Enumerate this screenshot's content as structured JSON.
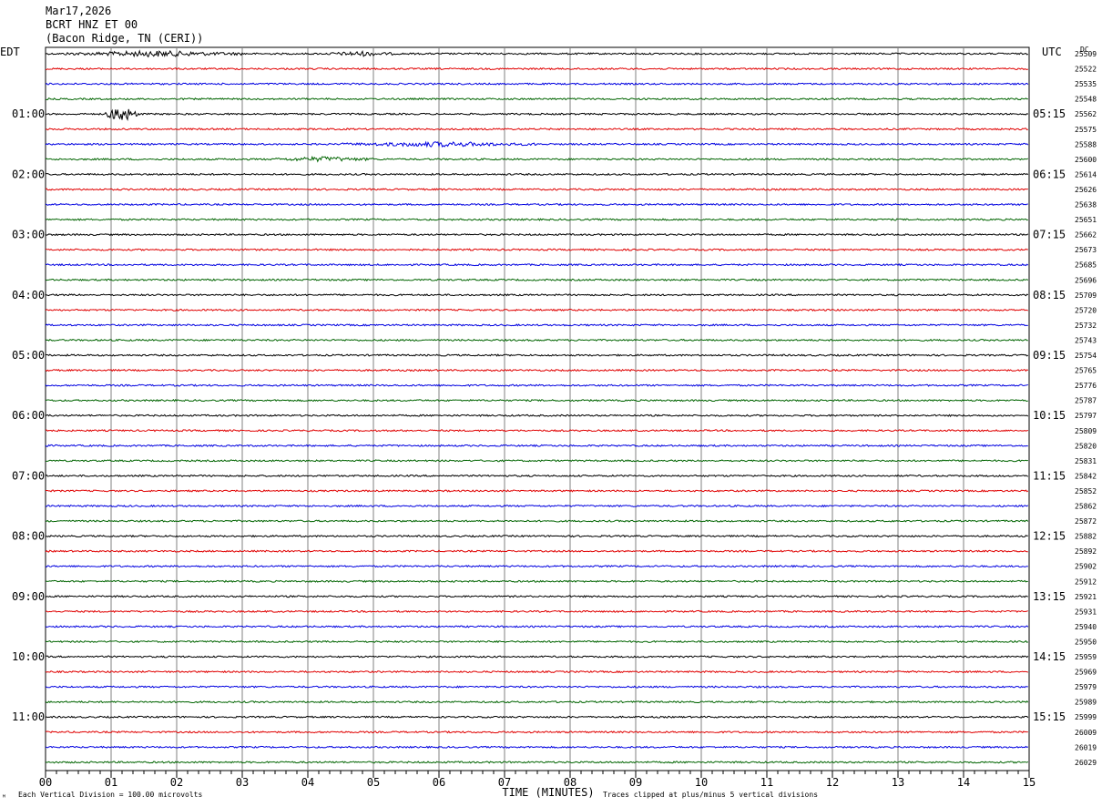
{
  "header": {
    "date": "Mar17,2026",
    "station": "BCRT HNZ ET 00",
    "location": "(Bacon Ridge, TN (CERI))"
  },
  "left_timezone": "EDT",
  "right_timezone": "UTC",
  "dc_label": "DC",
  "footer": {
    "scale_note": "Each Vertical Division =  100.00 microvolts",
    "clip_note": "Traces clipped at plus/minus 5 vertical divisions",
    "corner_mark": "ᴹ"
  },
  "colors": {
    "trace_cycle": [
      "#000000",
      "#e00000",
      "#0000e0",
      "#006400"
    ],
    "grid": "#808080",
    "background": "#ffffff"
  },
  "chart_data": {
    "type": "line",
    "title": "",
    "xlabel": "TIME (MINUTES)",
    "ylabel": "",
    "xlim": [
      0,
      15
    ],
    "x_ticks": [
      "00",
      "01",
      "02",
      "03",
      "04",
      "05",
      "06",
      "07",
      "08",
      "09",
      "10",
      "11",
      "12",
      "13",
      "14",
      "15"
    ],
    "grid": true,
    "row_count": 48,
    "left_hour_labels": [
      "01:00",
      "02:00",
      "03:00",
      "04:00",
      "05:00",
      "06:00",
      "07:00",
      "08:00",
      "09:00",
      "10:00",
      "11:00"
    ],
    "right_hour_labels": [
      "05:15",
      "06:15",
      "07:15",
      "08:15",
      "09:15",
      "10:15",
      "11:15",
      "12:15",
      "13:15",
      "14:15",
      "15:15"
    ],
    "hour_label_rows": [
      4,
      8,
      12,
      16,
      20,
      24,
      28,
      32,
      36,
      40,
      44
    ],
    "dc_offsets": [
      "25509",
      "25522",
      "25535",
      "25548",
      "25562",
      "25575",
      "25588",
      "25600",
      "25614",
      "25626",
      "25638",
      "25651",
      "25662",
      "25673",
      "25685",
      "25696",
      "25709",
      "25720",
      "25732",
      "25743",
      "25754",
      "25765",
      "25776",
      "25787",
      "25797",
      "25809",
      "25820",
      "25831",
      "25842",
      "25852",
      "25862",
      "25872",
      "25882",
      "25892",
      "25902",
      "25912",
      "25921",
      "25931",
      "25940",
      "25950",
      "25959",
      "25969",
      "25979",
      "25989",
      "25999",
      "26009",
      "26019",
      "26029"
    ],
    "events": [
      {
        "row": 0,
        "minute_start": 0.3,
        "minute_end": 3.0,
        "amplitude": 0.45
      },
      {
        "row": 0,
        "minute_start": 4.3,
        "minute_end": 5.3,
        "amplitude": 0.35
      },
      {
        "row": 4,
        "minute_start": 0.9,
        "minute_end": 1.4,
        "amplitude": 1.6
      },
      {
        "row": 6,
        "minute_start": 4.5,
        "minute_end": 7.5,
        "amplitude": 0.35
      },
      {
        "row": 7,
        "minute_start": 3.5,
        "minute_end": 5.0,
        "amplitude": 0.35
      }
    ]
  }
}
